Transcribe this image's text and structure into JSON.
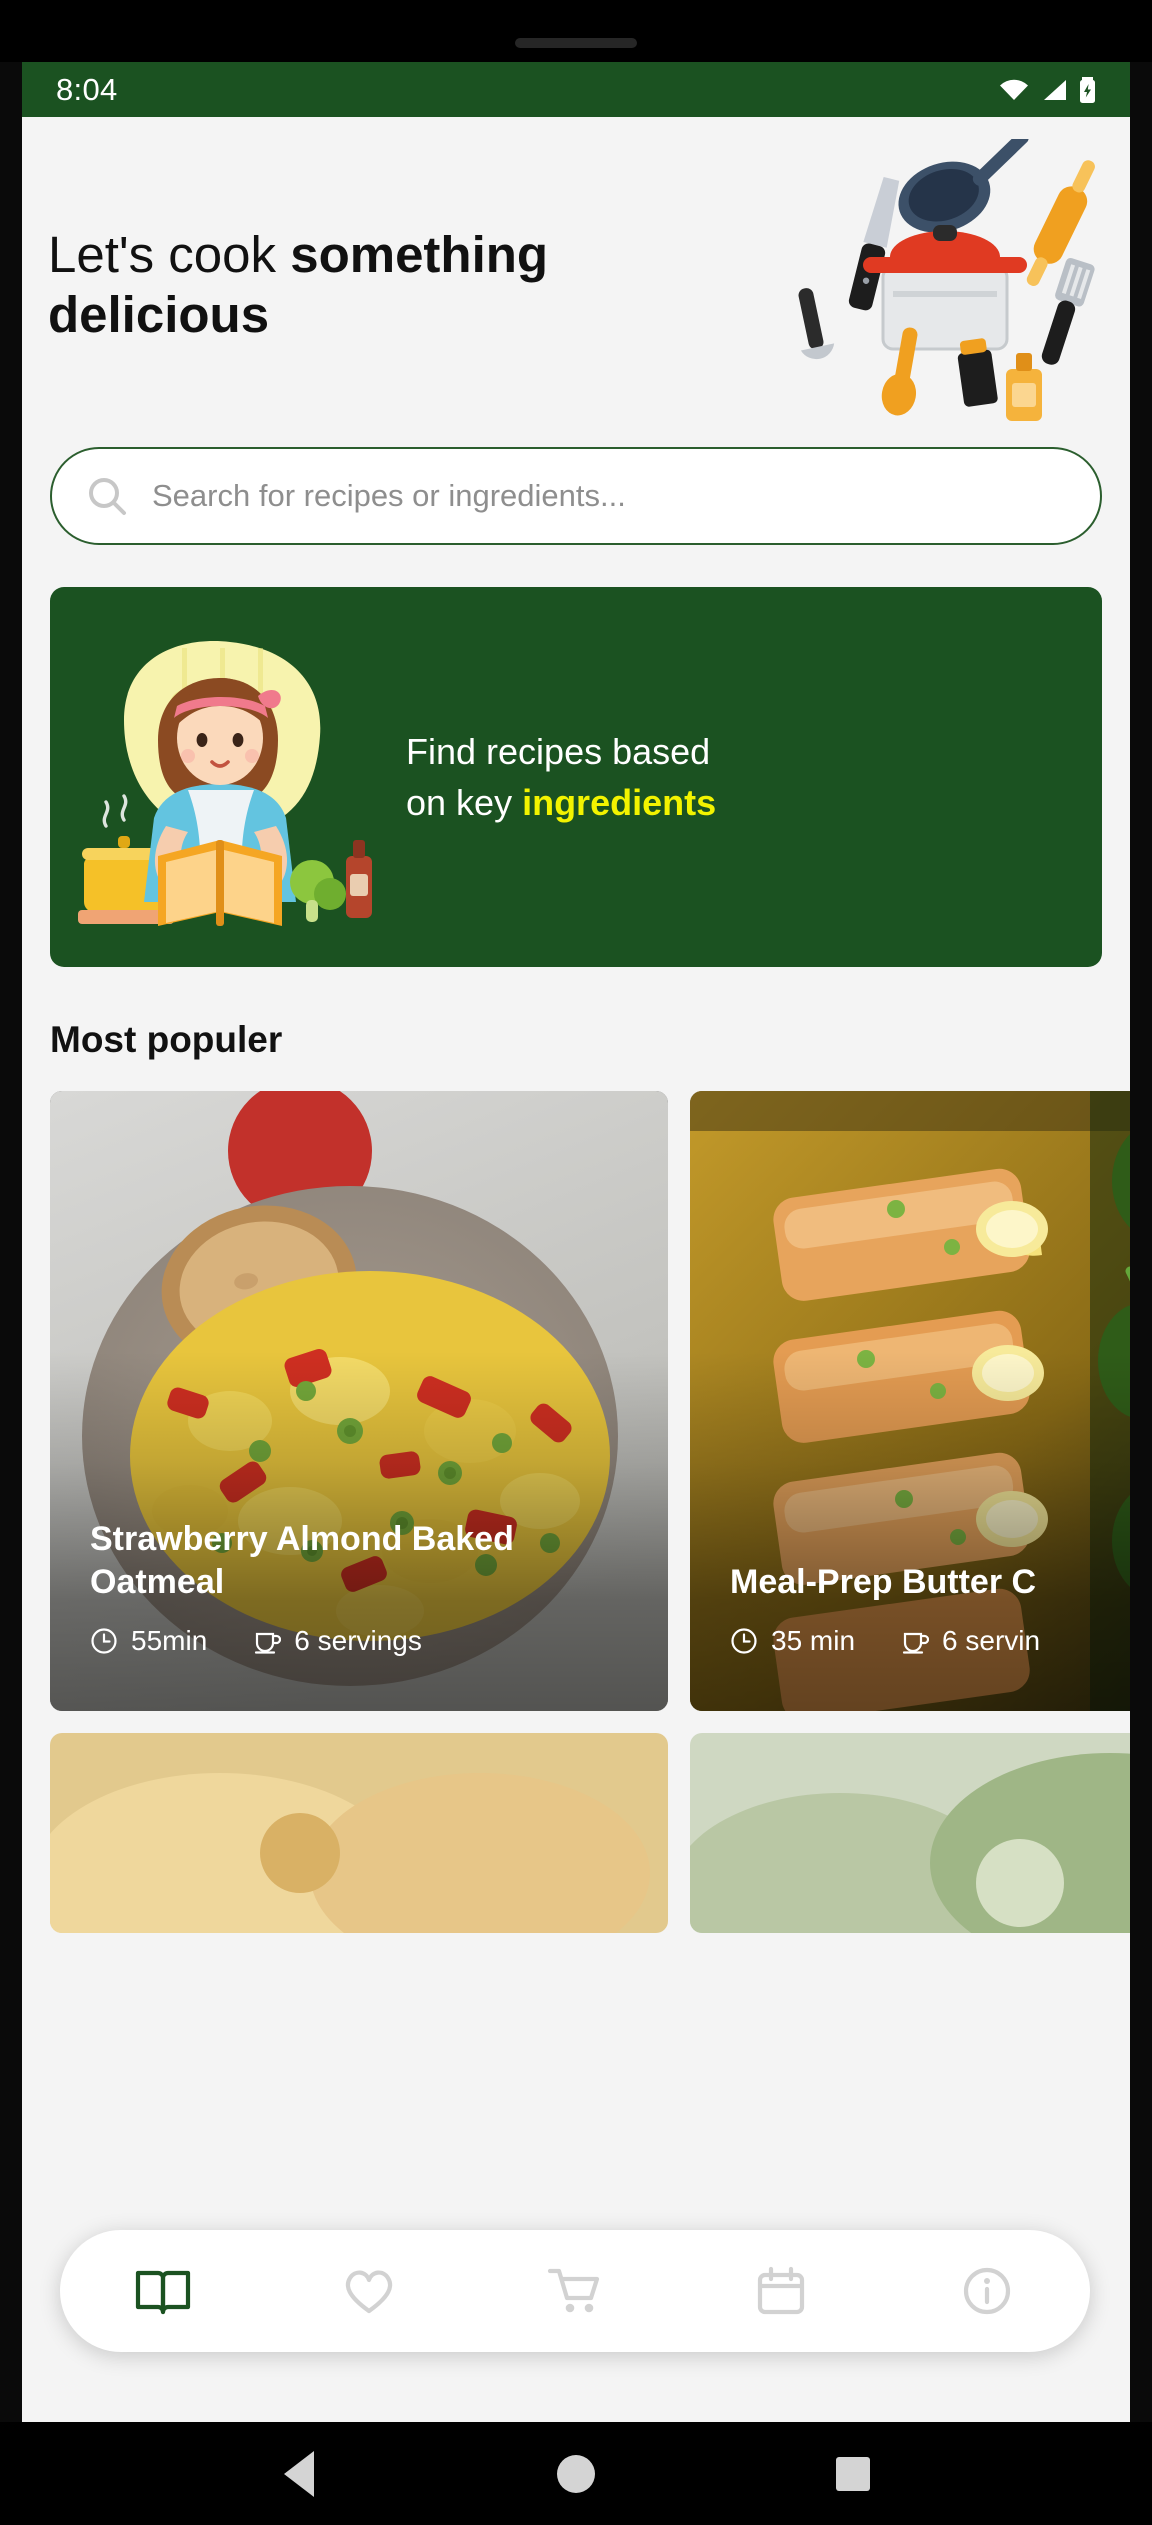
{
  "status_bar": {
    "time": "8:04",
    "icons": [
      "wifi-icon",
      "cellular-signal-icon",
      "battery-charging-icon"
    ],
    "background_color": "#1b5221"
  },
  "hero": {
    "title_plain": "Let's cook ",
    "title_bold": "something delicious",
    "illustration": "cooking-utensils-illustration"
  },
  "search": {
    "placeholder": "Search for recipes or ingredients...",
    "value": "",
    "icon": "search-icon",
    "border_color": "#2b5e2e"
  },
  "promo_banner": {
    "line1": "Find recipes based",
    "line2_prefix": "on key ",
    "line2_highlight": "ingredients",
    "illustration": "woman-reading-cookbook-illustration",
    "background_color": "#1b5221",
    "highlight_color": "#f3f300"
  },
  "section": {
    "title": "Most populer"
  },
  "recipe_cards": [
    {
      "name": "Strawberry Almond Baked\nOatmeal",
      "time": "55min",
      "servings": "6 servings",
      "time_icon": "clock-icon",
      "servings_icon": "serving-cup-icon",
      "image": "tofu-scramble-with-bread-photo"
    },
    {
      "name": "Meal-Prep Butter C",
      "time": "35 min",
      "servings": "6 servin",
      "time_icon": "clock-icon",
      "servings_icon": "serving-cup-icon",
      "image": "baked-salmon-with-broccolini-photo"
    }
  ],
  "bottom_nav": {
    "items": [
      {
        "icon": "open-book-icon",
        "active": true
      },
      {
        "icon": "heart-icon",
        "active": false
      },
      {
        "icon": "shopping-cart-icon",
        "active": false
      },
      {
        "icon": "calendar-icon",
        "active": false
      },
      {
        "icon": "info-icon",
        "active": false
      }
    ],
    "active_color": "#1b5221",
    "inactive_color": "#d2d2d2"
  },
  "system_nav": {
    "back": "back-triangle-icon",
    "home": "home-circle-icon",
    "recents": "recents-square-icon"
  }
}
